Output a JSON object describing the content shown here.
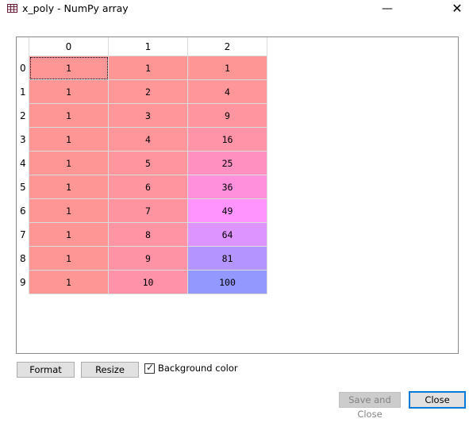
{
  "window": {
    "title": "x_poly - NumPy array",
    "icon": "table-grid-icon",
    "minimize_glyph": "—",
    "close_glyph": "✕"
  },
  "table": {
    "column_headers": [
      "0",
      "1",
      "2"
    ],
    "row_headers": [
      "0",
      "1",
      "2",
      "3",
      "4",
      "5",
      "6",
      "7",
      "8",
      "9"
    ],
    "rows": [
      [
        "1",
        "1",
        "1"
      ],
      [
        "1",
        "2",
        "4"
      ],
      [
        "1",
        "3",
        "9"
      ],
      [
        "1",
        "4",
        "16"
      ],
      [
        "1",
        "5",
        "25"
      ],
      [
        "1",
        "6",
        "36"
      ],
      [
        "1",
        "7",
        "49"
      ],
      [
        "1",
        "8",
        "64"
      ],
      [
        "1",
        "9",
        "81"
      ],
      [
        "1",
        "10",
        "100"
      ]
    ],
    "cell_colors": [
      [
        "#ff9696",
        "#ff9696",
        "#ff9696"
      ],
      [
        "#ff9696",
        "#ff9698",
        "#ff9699"
      ],
      [
        "#ff9696",
        "#ff9699",
        "#ff959e"
      ],
      [
        "#ff9696",
        "#ff969b",
        "#ff93a8"
      ],
      [
        "#ff9696",
        "#ff959d",
        "#ff90c0"
      ],
      [
        "#ff9696",
        "#ff959f",
        "#ff90dc"
      ],
      [
        "#ff9696",
        "#ff94a1",
        "#ff94ff"
      ],
      [
        "#ff9696",
        "#ff94a4",
        "#dd94ff"
      ],
      [
        "#ff9696",
        "#ff93a6",
        "#b494ff"
      ],
      [
        "#ff9696",
        "#ff92a9",
        "#9398ff"
      ]
    ],
    "focused_cell": [
      0,
      0
    ]
  },
  "controls": {
    "format_label": "Format",
    "resize_label": "Resize",
    "background_color_label": "Background color",
    "background_color_checked": true,
    "save_and_close_label": "Save and Close",
    "close_label": "Close"
  }
}
